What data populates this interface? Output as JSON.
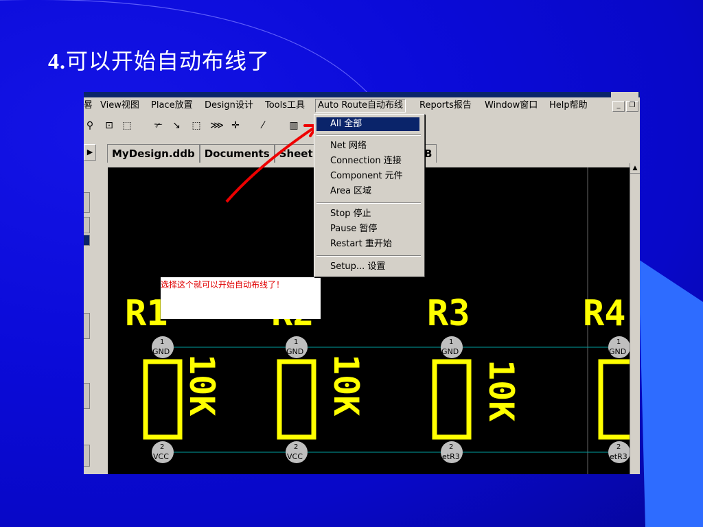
{
  "slide": {
    "title_num": "4.",
    "title_text": "可以开始自动布线了"
  },
  "menubar": {
    "items": [
      "晷",
      "View视图",
      "Place放置",
      "Design设计",
      "Tools工具",
      "Auto Route自动布线",
      "Reports报告",
      "Window窗口",
      "Help帮助"
    ],
    "active_index": 5
  },
  "toolbar": {
    "icons": [
      "zoom-out-icon",
      "zoom-area-icon",
      "zoom-select-icon",
      "wire-icon",
      "line-icon",
      "rect-select-icon",
      "component-icon",
      "move-icon",
      "magic-wand-icon",
      "hole-icon"
    ]
  },
  "tabs": {
    "items": [
      "MyDesign.ddb",
      "Documents",
      "Sheet"
    ],
    "tail": "B"
  },
  "dropdown": {
    "items": [
      {
        "label": "All 全部",
        "selected": true
      },
      {
        "sep": true
      },
      {
        "label": "Net 网络"
      },
      {
        "label": "Connection 连接"
      },
      {
        "label": "Component 元件"
      },
      {
        "label": "Area 区域"
      },
      {
        "sep": true
      },
      {
        "label": "Stop 停止"
      },
      {
        "label": "Pause 暂停"
      },
      {
        "label": "Restart 重开始"
      },
      {
        "sep": true
      },
      {
        "label": "Setup... 设置"
      }
    ]
  },
  "annotation": {
    "text": "选择这个就可以开始自动布线了！"
  },
  "pcb": {
    "components": [
      {
        "ref": "R1",
        "value": "10K",
        "pad1_net": "GND",
        "pad2_net": "VCC"
      },
      {
        "ref": "R2",
        "value": "10K",
        "pad1_net": "GND",
        "pad2_net": "VCC"
      },
      {
        "ref": "R3",
        "value": "10K",
        "pad1_net": "GND",
        "pad2_net": "etR3"
      },
      {
        "ref": "R4",
        "value": "",
        "pad1_net": "GND",
        "pad2_net": "etR3"
      }
    ],
    "pad1_num": "1",
    "pad2_num": "2"
  },
  "colors": {
    "slide_bg": "#0b0bd9",
    "silkscreen": "#ffff00",
    "ratsnest": "#00a0a0",
    "arrow": "#ee0000",
    "menu_highlight": "#0a246a"
  }
}
